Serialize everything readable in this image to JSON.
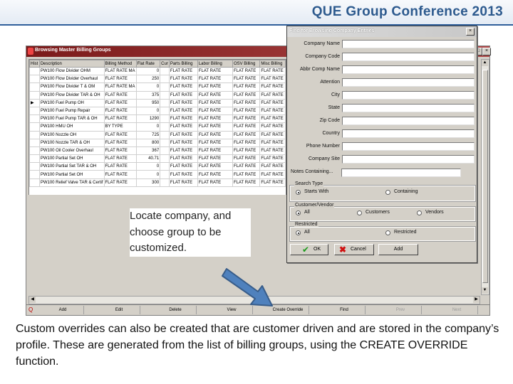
{
  "header": {
    "title": "QUE Group Conference 2013",
    "accent_color": "#2d5a8e"
  },
  "billing_window": {
    "title": "Browsing Master Billing Groups",
    "columns": [
      "Hist",
      "Description",
      "Billing Method",
      "Flat Rate",
      "Cur",
      "Parts Billing",
      "Labor Billing",
      "OSV Billing",
      "Misc Billing"
    ],
    "rows": [
      {
        "description": "PW100 Flow Divider OHM",
        "method": "FLAT RATE MA",
        "rate": "0",
        "parts": "FLAT RATE",
        "labor": "FLAT RATE",
        "osv": "FLAT RATE",
        "misc": "FLAT RATE"
      },
      {
        "description": "PW100 Flow Divider Overhaul",
        "method": "FLAT RATE",
        "rate": "250",
        "parts": "FLAT RATE",
        "labor": "FLAT RATE",
        "osv": "FLAT RATE",
        "misc": "FLAT RATE"
      },
      {
        "description": "PW100 Flow Divider T & OM",
        "method": "FLAT RATE MA",
        "rate": "0",
        "parts": "FLAT RATE",
        "labor": "FLAT RATE",
        "osv": "FLAT RATE",
        "misc": "FLAT RATE"
      },
      {
        "description": "PW100 Flow Divider TAR & OH",
        "method": "FLAT RATE",
        "rate": "375",
        "parts": "FLAT RATE",
        "labor": "FLAT RATE",
        "osv": "FLAT RATE",
        "misc": "FLAT RATE"
      },
      {
        "description": "PW100 Fuel Pump OH",
        "method": "FLAT RATE",
        "rate": "950",
        "parts": "FLAT RATE",
        "labor": "FLAT RATE",
        "osv": "FLAT RATE",
        "misc": "FLAT RATE",
        "selected": true
      },
      {
        "description": "PW100 Fuel Pump Repair",
        "method": "FLAT RATE",
        "rate": "0",
        "parts": "FLAT RATE",
        "labor": "FLAT RATE",
        "osv": "FLAT RATE",
        "misc": "FLAT RATE"
      },
      {
        "description": "PW100 Fuel Pump TAR & OH",
        "method": "FLAT RATE",
        "rate": "1290",
        "parts": "FLAT RATE",
        "labor": "FLAT RATE",
        "osv": "FLAT RATE",
        "misc": "FLAT RATE"
      },
      {
        "description": "PW100 HMU OH",
        "method": "BY TYPE",
        "rate": "0",
        "parts": "FLAT RATE",
        "labor": "FLAT RATE",
        "osv": "FLAT RATE",
        "misc": "FLAT RATE"
      },
      {
        "description": "PW100 Nozzle OH",
        "method": "FLAT RATE",
        "rate": "725",
        "parts": "FLAT RATE",
        "labor": "FLAT RATE",
        "osv": "FLAT RATE",
        "misc": "FLAT RATE"
      },
      {
        "description": "PW100 Nozzle TAR & OH",
        "method": "FLAT RATE",
        "rate": "800",
        "parts": "FLAT RATE",
        "labor": "FLAT RATE",
        "osv": "FLAT RATE",
        "misc": "FLAT RATE"
      },
      {
        "description": "PW100 Oil Cooler Overhaul",
        "method": "FLAT RATE",
        "rate": "367",
        "parts": "FLAT RATE",
        "labor": "FLAT RATE",
        "osv": "FLAT RATE",
        "misc": "FLAT RATE"
      },
      {
        "description": "PW100 Partial Set OH",
        "method": "FLAT RATE",
        "rate": "40.71",
        "parts": "FLAT RATE",
        "labor": "FLAT RATE",
        "osv": "FLAT RATE",
        "misc": "FLAT RATE"
      },
      {
        "description": "PW100 Partial Set TAR & OH",
        "method": "FLAT RATE",
        "rate": "0",
        "parts": "FLAT RATE",
        "labor": "FLAT RATE",
        "osv": "FLAT RATE",
        "misc": "FLAT RATE"
      },
      {
        "description": "PW100 Partial Set OH",
        "method": "FLAT RATE",
        "rate": "0",
        "parts": "FLAT RATE",
        "labor": "FLAT RATE",
        "osv": "FLAT RATE",
        "misc": "FLAT RATE"
      },
      {
        "description": "PW100 Relief Valve TAR & Certif",
        "method": "FLAT RATE",
        "rate": "300",
        "parts": "FLAT RATE",
        "labor": "FLAT RATE",
        "osv": "FLAT RATE",
        "misc": "FLAT RATE"
      }
    ],
    "toolbar": [
      {
        "label": "Add",
        "enabled": true
      },
      {
        "label": "Edit",
        "enabled": true
      },
      {
        "label": "Delete",
        "enabled": true
      },
      {
        "label": "View",
        "enabled": true
      },
      {
        "label": "Create Override",
        "enabled": true
      },
      {
        "label": "Find",
        "enabled": true
      },
      {
        "label": "Prev",
        "enabled": false
      },
      {
        "label": "Next",
        "enabled": false
      }
    ]
  },
  "find_dialog": {
    "title": "Find for Browsing Company Entries",
    "fields": [
      "Company Name",
      "Company Code",
      "Abbr Comp Name",
      "Attention",
      "City",
      "State",
      "Zip Code",
      "Country",
      "Phone Number",
      "Company Site"
    ],
    "notes_label": "Notes Containing...",
    "search_type": {
      "label": "Search Type",
      "options": [
        "Starts With",
        "Containing"
      ],
      "selected": "Starts With"
    },
    "customer_vendor": {
      "label": "Customer/Vendor",
      "options": [
        "All",
        "Customers",
        "Vendors"
      ],
      "selected": "All"
    },
    "restricted": {
      "label": "Restricted",
      "options": [
        "All",
        "Restricted"
      ],
      "selected": "All"
    },
    "buttons": {
      "ok": "OK",
      "cancel": "Cancel",
      "add": "Add"
    }
  },
  "callout": "Locate company, and choose group to be customized.",
  "caption": "Custom overrides can also be created that are customer driven and are stored in the company’s profile.  These are generated from the list of billing groups, using the CREATE OVERRIDE function."
}
